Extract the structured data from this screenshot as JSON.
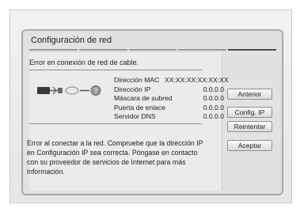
{
  "dialog": {
    "title": "Configuración de red",
    "error_message": "Error en conexión de red de cable.",
    "network_info": [
      {
        "label": "Dirección MAC",
        "value": "XX:XX:XX:XX:XX:XX"
      },
      {
        "label": "Dirección IP",
        "value": "0.0.0.0"
      },
      {
        "label": "Máscara de subred",
        "value": "0.0.0.0"
      },
      {
        "label": "Puerta de enlace",
        "value": "0.0.0.0"
      },
      {
        "label": "Servidor DNS",
        "value": "0.0.0.0"
      }
    ],
    "description": "Error al conectar a la red. Compruebe que la dirección IP en Configuración IP sea correcta. Póngase en contacto con su proveedor de servicios de Internet para más información.",
    "buttons": {
      "previous": "Anterior",
      "ip_settings": "Config. IP",
      "retry": "Reintentar",
      "accept": "Aceptar"
    }
  }
}
